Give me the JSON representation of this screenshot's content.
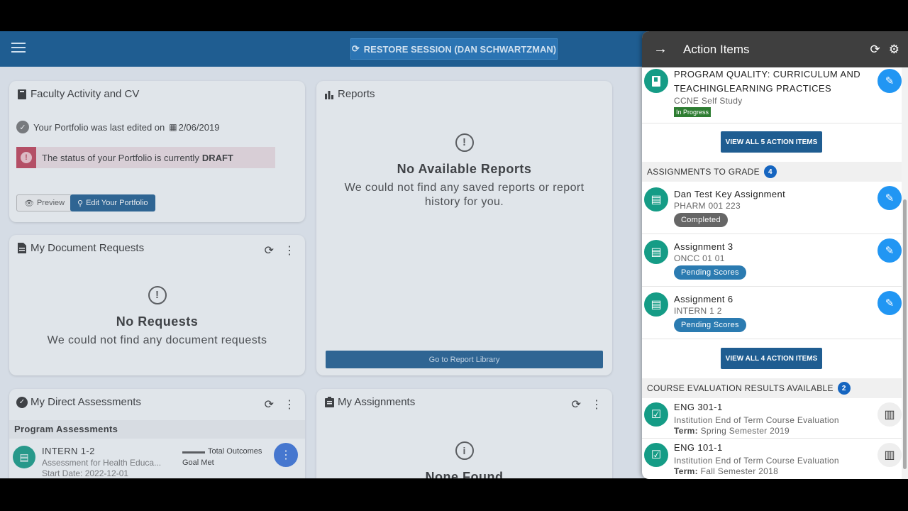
{
  "topbar": {
    "restore_label": "RESTORE SESSION (DAN SCHWARTZMAN)"
  },
  "faculty": {
    "title": "Faculty Activity and CV",
    "edited_text": "Your Portfolio was last edited on",
    "edited_date": "2/06/2019",
    "status_text": "The status of your Portfolio is currently",
    "status_value": "DRAFT",
    "preview_label": "Preview",
    "edit_label": "Edit Your Portfolio"
  },
  "reports": {
    "title": "Reports",
    "empty_title": "No Available Reports",
    "empty_text": "We could not find any saved reports or report history for you.",
    "library_label": "Go to Report Library"
  },
  "doc_requests": {
    "title": "My Document Requests",
    "empty_title": "No Requests",
    "empty_text": "We could not find any document requests"
  },
  "direct_assessments": {
    "title": "My Direct Assessments",
    "section": "Program Assessments",
    "item_title": "INTERN 1-2",
    "item_sub": "Assessment for Health Educa...",
    "item_date": "Start Date: 2022-12-01",
    "outcome_label": "Total Outcomes",
    "goal_label": "Goal Met"
  },
  "my_assignments": {
    "title": "My Assignments",
    "empty_title": "None Found"
  },
  "panel": {
    "title": "Action Items",
    "program": {
      "title": "PROGRAM QUALITY: CURRICULUM AND TEACHINGLEARNING PRACTICES",
      "sub": "CCNE Self Study",
      "status": "In Progress",
      "view_all": "VIEW ALL 5 ACTION ITEMS"
    },
    "grade_section": {
      "label": "ASSIGNMENTS TO GRADE",
      "count": "4"
    },
    "assignments": [
      {
        "title": "Dan Test Key Assignment",
        "sub": "PHARM 001 223",
        "status": "Completed"
      },
      {
        "title": "Assignment 3",
        "sub": "ONCC 01 01",
        "status": "Pending Scores"
      },
      {
        "title": "Assignment 6",
        "sub": "INTERN 1 2",
        "status": "Pending Scores"
      }
    ],
    "grade_view_all": "VIEW ALL 4 ACTION ITEMS",
    "eval_section": {
      "label": "COURSE EVALUATION RESULTS AVAILABLE",
      "count": "2"
    },
    "evaluations": [
      {
        "title": "ENG 301-1",
        "sub": "Institution End of Term Course Evaluation",
        "term_label": "Term:",
        "term": "Spring Semester 2019"
      },
      {
        "title": "ENG 101-1",
        "sub": "Institution End of Term Course Evaluation",
        "term_label": "Term:",
        "term": "Fall Semester 2018"
      }
    ]
  },
  "colors": {
    "primary": "#1f5d91",
    "teal": "#159c86",
    "edit_blue": "#2196f3"
  }
}
